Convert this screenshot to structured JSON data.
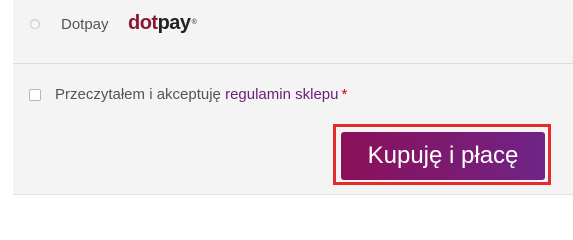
{
  "payment_method": {
    "label": "Dotpay",
    "logo": {
      "part1": "dot",
      "part2": "pay",
      "registered": "®",
      "color_dot": "#8b1733",
      "color_pay": "#222222"
    }
  },
  "terms": {
    "text": "Przeczytałem i akceptuję",
    "link_text": "regulamin sklepu",
    "required_mark": "*"
  },
  "submit": {
    "label": "Kupuję i płacę",
    "gradient_start": "#8b1059",
    "gradient_end": "#6f2486"
  },
  "highlight_color": "#e52c2c"
}
